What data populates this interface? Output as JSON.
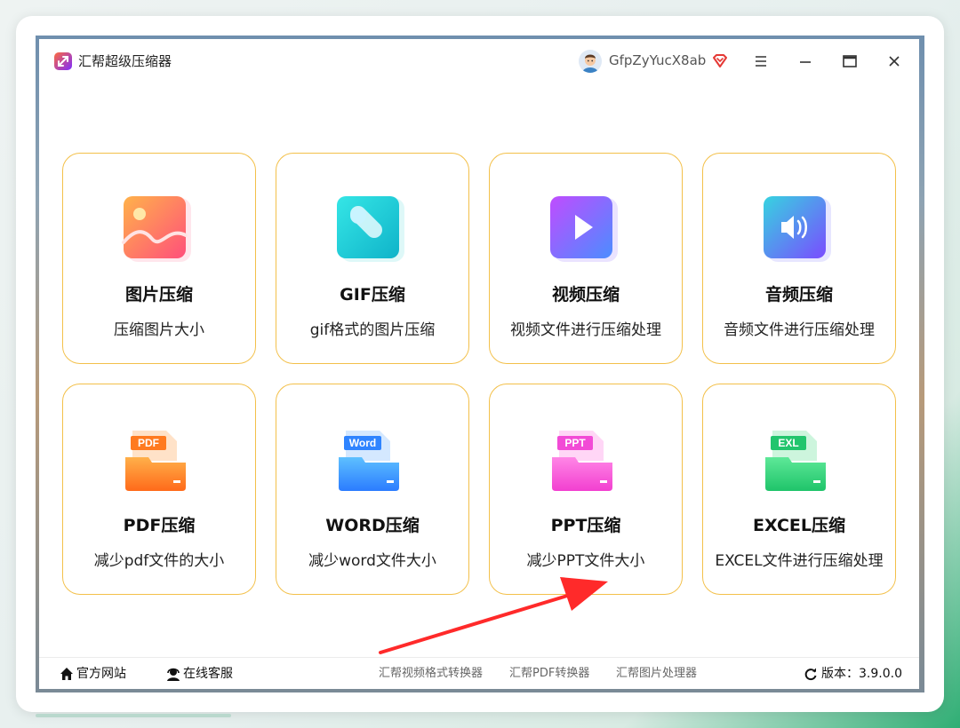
{
  "app": {
    "title": "汇帮超级压缩器",
    "username": "GfpZyYucX8ab",
    "accent_color": "#f3c04a"
  },
  "window_controls": {
    "menu_icon": "hamburger-icon",
    "minimize_icon": "minimize-icon",
    "maximize_icon": "maximize-icon",
    "close_icon": "close-icon"
  },
  "tools": [
    {
      "title": "图片压缩",
      "desc": "压缩图片大小",
      "icon": "image-icon"
    },
    {
      "title": "GIF压缩",
      "desc": "gif格式的图片压缩",
      "icon": "gif-icon"
    },
    {
      "title": "视频压缩",
      "desc": "视频文件进行压缩处理",
      "icon": "video-play-icon"
    },
    {
      "title": "音频压缩",
      "desc": "音频文件进行压缩处理",
      "icon": "speaker-icon"
    },
    {
      "title": "PDF压缩",
      "desc": "减少pdf文件的大小",
      "icon": "pdf-folder-icon",
      "badge": "PDF"
    },
    {
      "title": "WORD压缩",
      "desc": "减少word文件大小",
      "icon": "word-folder-icon",
      "badge": "Word"
    },
    {
      "title": "PPT压缩",
      "desc": "减少PPT文件大小",
      "icon": "ppt-folder-icon",
      "badge": "PPT"
    },
    {
      "title": "EXCEL压缩",
      "desc": "EXCEL文件进行压缩处理",
      "icon": "excel-folder-icon",
      "badge": "EXL"
    }
  ],
  "footer": {
    "website": "官方网站",
    "support": "在线客服",
    "apps": [
      "汇帮视频格式转换器",
      "汇帮PDF转换器",
      "汇帮图片处理器"
    ],
    "version": "版本：3.9.0.0"
  }
}
